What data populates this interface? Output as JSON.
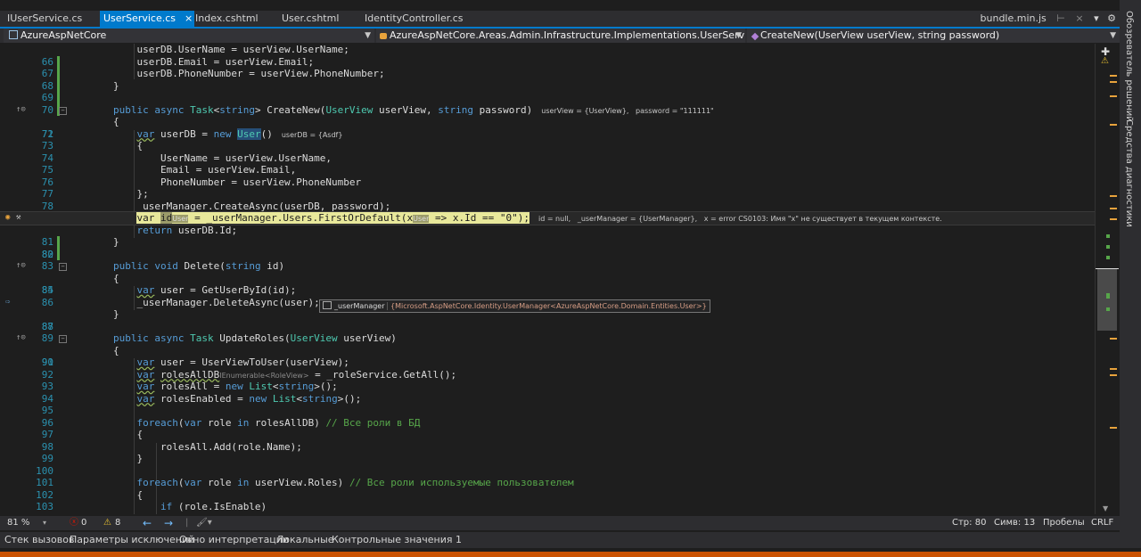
{
  "tabs": [
    {
      "label": "IUserService.cs"
    },
    {
      "label": "UserService.cs",
      "active": true
    },
    {
      "label": "Index.cshtml"
    },
    {
      "label": "User.cshtml"
    },
    {
      "label": "IdentityController.cs"
    }
  ],
  "tab_close_glyph": "×",
  "tab_right": {
    "label": "bundle.min.js",
    "pin": "⊢",
    "close": "×"
  },
  "nav": {
    "project": "AzureAspNetCore",
    "class": "AzureAspNetCore.Areas.Admin.Infrastructure.Implementations.UserService",
    "member": "CreateNew(UserView userView, string password)"
  },
  "lines": [
    {
      "n": "66",
      "code": "            userDB.UserName = userView.UserName;"
    },
    {
      "n": "67",
      "code": "            userDB.Email = userView.Email;"
    },
    {
      "n": "68",
      "code": "            userDB.PhoneNumber = userView.PhoneNumber;"
    },
    {
      "n": "69",
      "code": "        }"
    },
    {
      "n": "70",
      "code": ""
    },
    {
      "n": "71",
      "code": "        public async Task<string> CreateNew(UserView userView, string password)"
    },
    {
      "n": "72",
      "code": "        {"
    },
    {
      "n": "73",
      "code": "            var userDB = new User()"
    },
    {
      "n": "74",
      "code": "            {"
    },
    {
      "n": "75",
      "code": "                UserName = userView.UserName,"
    },
    {
      "n": "76",
      "code": "                Email = userView.Email,"
    },
    {
      "n": "77",
      "code": "                PhoneNumber = userView.PhoneNumber"
    },
    {
      "n": "78",
      "code": "            };"
    },
    {
      "n": "79",
      "code": "            _userManager.CreateAsync(userDB, password);"
    },
    {
      "n": "80",
      "code": "            var id = _userManager.Users.FirstOrDefault(x => x.Id == \"0\");"
    },
    {
      "n": "81",
      "code": "            return userDB.Id;"
    },
    {
      "n": "82",
      "code": "        }"
    },
    {
      "n": "83",
      "code": ""
    },
    {
      "n": "84",
      "code": "        public void Delete(string id)"
    },
    {
      "n": "85",
      "code": "        {"
    },
    {
      "n": "86",
      "code": "            var user = GetUserById(id);"
    },
    {
      "n": "87",
      "code": "            _userManager.DeleteAsync(user);"
    },
    {
      "n": "88",
      "code": "        }"
    },
    {
      "n": "89",
      "code": ""
    },
    {
      "n": "90",
      "code": "        public async Task UpdateRoles(UserView userView)"
    },
    {
      "n": "91",
      "code": "        {"
    },
    {
      "n": "92",
      "code": "            var user = UserViewToUser(userView);"
    },
    {
      "n": "93",
      "code": "            var rolesAllDB = _roleService.GetAll();"
    },
    {
      "n": "94",
      "code": "            var rolesAll = new List<string>();"
    },
    {
      "n": "95",
      "code": "            var rolesEnabled = new List<string>();"
    },
    {
      "n": "96",
      "code": ""
    },
    {
      "n": "97",
      "code": "            foreach(var role in rolesAllDB) // Все роли в БД"
    },
    {
      "n": "98",
      "code": "            {"
    },
    {
      "n": "99",
      "code": "                rolesAll.Add(role.Name);"
    },
    {
      "n": "100",
      "code": "            }"
    },
    {
      "n": "101",
      "code": ""
    },
    {
      "n": "102",
      "code": "            foreach(var role in userView.Roles) // Все роли используемые пользователем"
    },
    {
      "n": "103",
      "code": "            {"
    },
    {
      "n": "104",
      "code": "                if (role.IsEnable)"
    }
  ],
  "inline_values": {
    "l71": "userView = {UserView},   password = \"111111\"",
    "l73": "userDB = {Asdf}",
    "l80": "id = null,   _userManager = {UserManager},   x = error CS0103: Имя \"x\" не существует в текущем контексте.",
    "l80_type_id": "User",
    "l80_type_x": "User",
    "l93_type": "IEnumerable<RoleView>"
  },
  "tooltip": {
    "name": "_userManager",
    "value": "{Microsoft.AspNetCore.Identity.UserManager<AzureAspNetCore.Domain.Entities.User>}"
  },
  "side_panel": {
    "solution_explorer": "Обозреватель решений",
    "diagnostics": "Средства диагностики"
  },
  "status": {
    "zoom": "81 %",
    "errors": "0",
    "warnings": "8",
    "line": "Стр: 80",
    "col": "Симв: 13",
    "spaces": "Пробелы",
    "eol": "CRLF"
  },
  "bottom_tabs": [
    "Стек вызовов",
    "Параметры исключений",
    "Окно интерпретации",
    "Локальные",
    "Контрольные значения 1"
  ],
  "colors": {
    "accent": "#007acc",
    "status_orange": "#ca5100",
    "keyword": "#569cd6",
    "type": "#4ec9b0",
    "comment": "#57a64a",
    "string": "#d69d85"
  }
}
